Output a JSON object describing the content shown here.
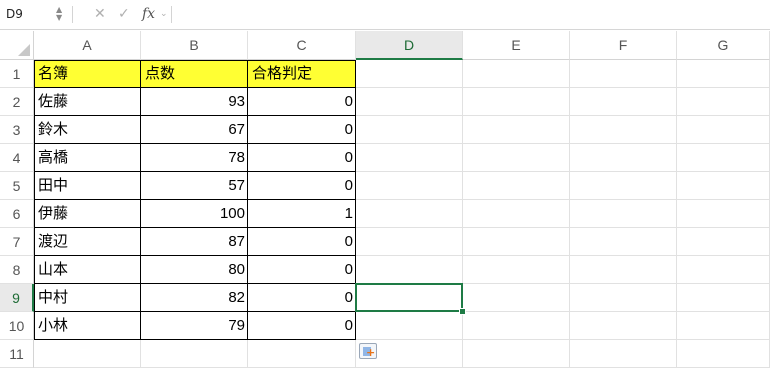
{
  "formula_bar": {
    "name_box": "D9",
    "cancel_icon": "close-icon",
    "confirm_icon": "check-icon",
    "fx": "fx",
    "formula": ""
  },
  "columns": [
    "A",
    "B",
    "C",
    "D",
    "E",
    "F",
    "G"
  ],
  "active_column": "D",
  "rows": [
    "1",
    "2",
    "3",
    "4",
    "5",
    "6",
    "7",
    "8",
    "9",
    "10",
    "11"
  ],
  "active_row": "9",
  "header_fill_color": "#ffff33",
  "selection_color": "#1e7b45",
  "table": {
    "headers": [
      "名簿",
      "点数",
      "合格判定"
    ],
    "records": [
      {
        "name": "佐藤",
        "score": "93",
        "pass": "0"
      },
      {
        "name": "鈴木",
        "score": "67",
        "pass": "0"
      },
      {
        "name": "高橋",
        "score": "78",
        "pass": "0"
      },
      {
        "name": "田中",
        "score": "57",
        "pass": "0"
      },
      {
        "name": "伊藤",
        "score": "100",
        "pass": "1"
      },
      {
        "name": "渡辺",
        "score": "87",
        "pass": "0"
      },
      {
        "name": "山本",
        "score": "80",
        "pass": "0"
      },
      {
        "name": "中村",
        "score": "82",
        "pass": "0"
      },
      {
        "name": "小林",
        "score": "79",
        "pass": "0"
      }
    ]
  },
  "selected_cell": "D9",
  "paste_options_icon": "paste-options-icon"
}
